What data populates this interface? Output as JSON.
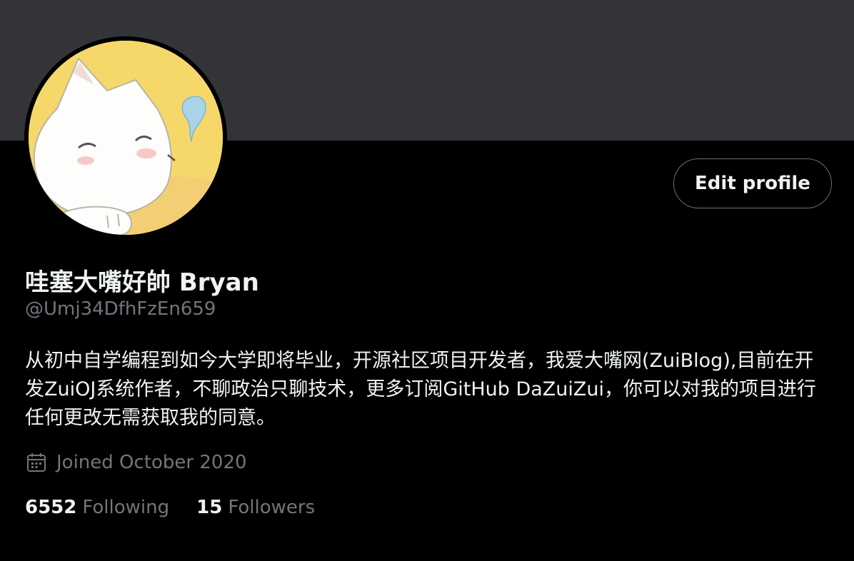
{
  "profile": {
    "display_name": "哇塞大嘴好帥 Bryan",
    "handle": "@Umj34DfhFzEn659",
    "bio": "从初中自学编程到如今大学即将毕业，开源社区项目开发者，我爱大嘴网(ZuiBlog),目前在开发ZuiOJ系统作者，不聊政治只聊技术，更多订阅GitHub DaZuiZui，你可以对我的项目进行任何更改无需获取我的同意。",
    "joined": "Joined October 2020",
    "joined_icon": "calendar-icon",
    "following_count": "6552",
    "following_label": "Following",
    "followers_count": "15",
    "followers_label": "Followers"
  },
  "actions": {
    "edit_profile_label": "Edit profile"
  },
  "colors": {
    "background": "#000000",
    "banner": "#333438",
    "text_primary": "#eff3f4",
    "text_secondary": "#71767b",
    "button_border": "#6a6f74",
    "avatar_bg": "#f6d86a"
  }
}
